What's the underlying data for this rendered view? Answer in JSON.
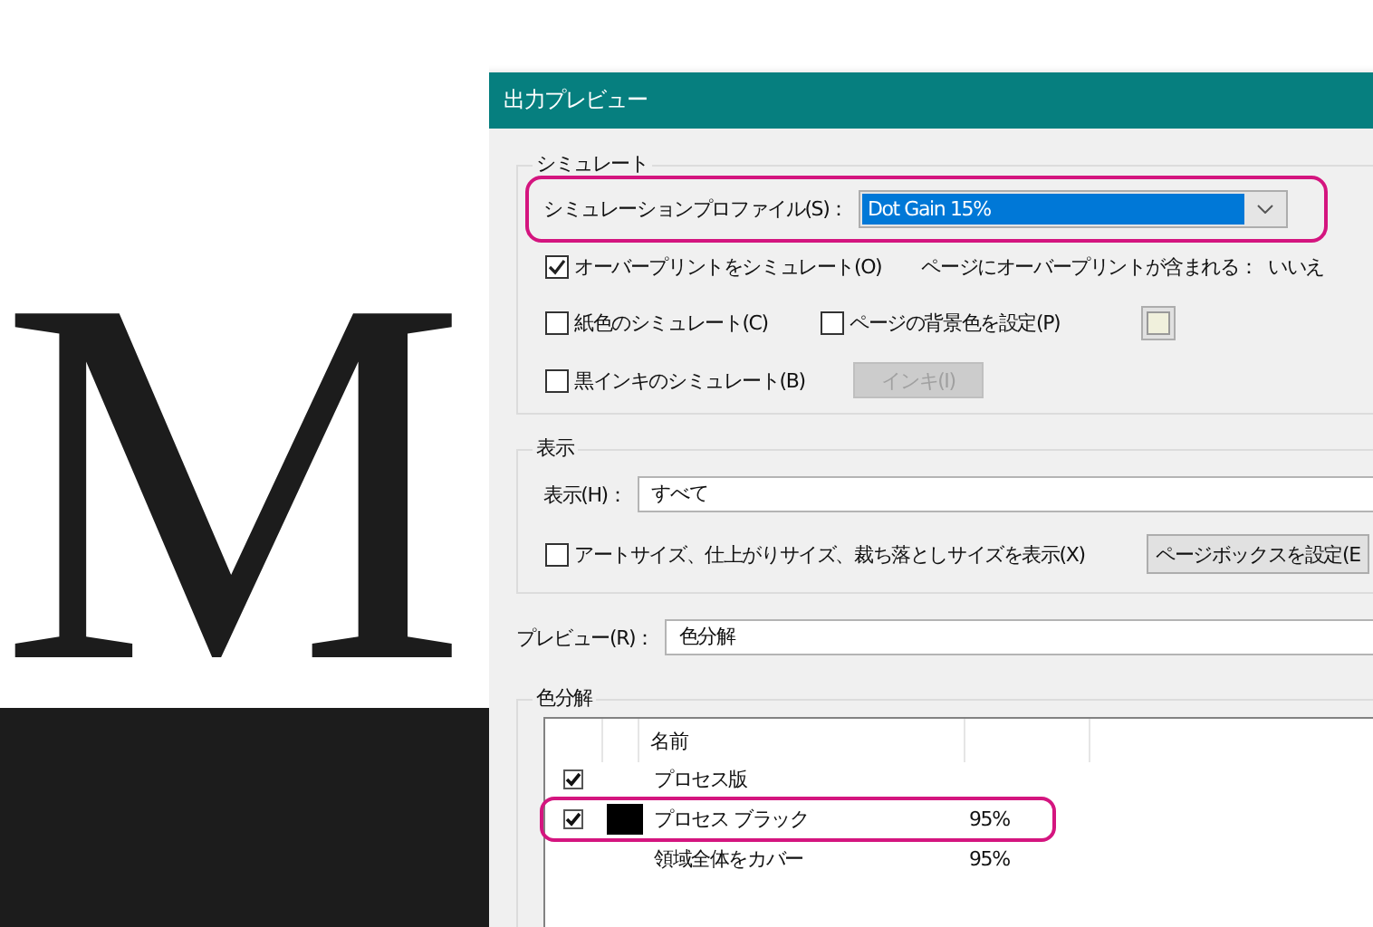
{
  "document": {
    "letter": "M"
  },
  "window": {
    "title": "出力プレビュー"
  },
  "simulate": {
    "legend": "シミュレート",
    "profile": {
      "label": "シミュレーションプロファイル(S)：",
      "value": "Dot Gain 15%",
      "highlighted": true
    },
    "overprint": {
      "label": "オーバープリントをシミュレート(O)",
      "checked": true
    },
    "overprint_info": {
      "label": "ページにオーバープリントが含まれる：",
      "value": "いいえ"
    },
    "paper": {
      "label": "紙色のシミュレート(C)",
      "checked": false
    },
    "background": {
      "label": "ページの背景色を設定(P)",
      "checked": false,
      "color": "#f0f0dc"
    },
    "black_ink": {
      "label": "黒インキのシミュレート(B)",
      "checked": false
    },
    "ink_button": {
      "label": "インキ(I)",
      "disabled": true
    }
  },
  "display": {
    "legend": "表示",
    "field_label": "表示(H)：",
    "value": "すべて",
    "sizes": {
      "label": "アートサイズ、仕上がりサイズ、裁ち落としサイズを表示(X)",
      "checked": false
    },
    "page_box_button": "ページボックスを設定(E"
  },
  "preview": {
    "label": "プレビュー(R)：",
    "value": "色分解"
  },
  "separations": {
    "legend": "色分解",
    "columns": [
      "名前"
    ],
    "rows": [
      {
        "kind": "group",
        "name": "プロセス版",
        "checked": true,
        "highlighted": false
      },
      {
        "kind": "ink",
        "name": "プロセス ブラック",
        "checked": true,
        "color": "#000000",
        "coverage": "95%",
        "highlighted": true
      },
      {
        "kind": "total",
        "name": "領域全体をカバー",
        "coverage": "95%",
        "highlighted": false
      }
    ]
  }
}
